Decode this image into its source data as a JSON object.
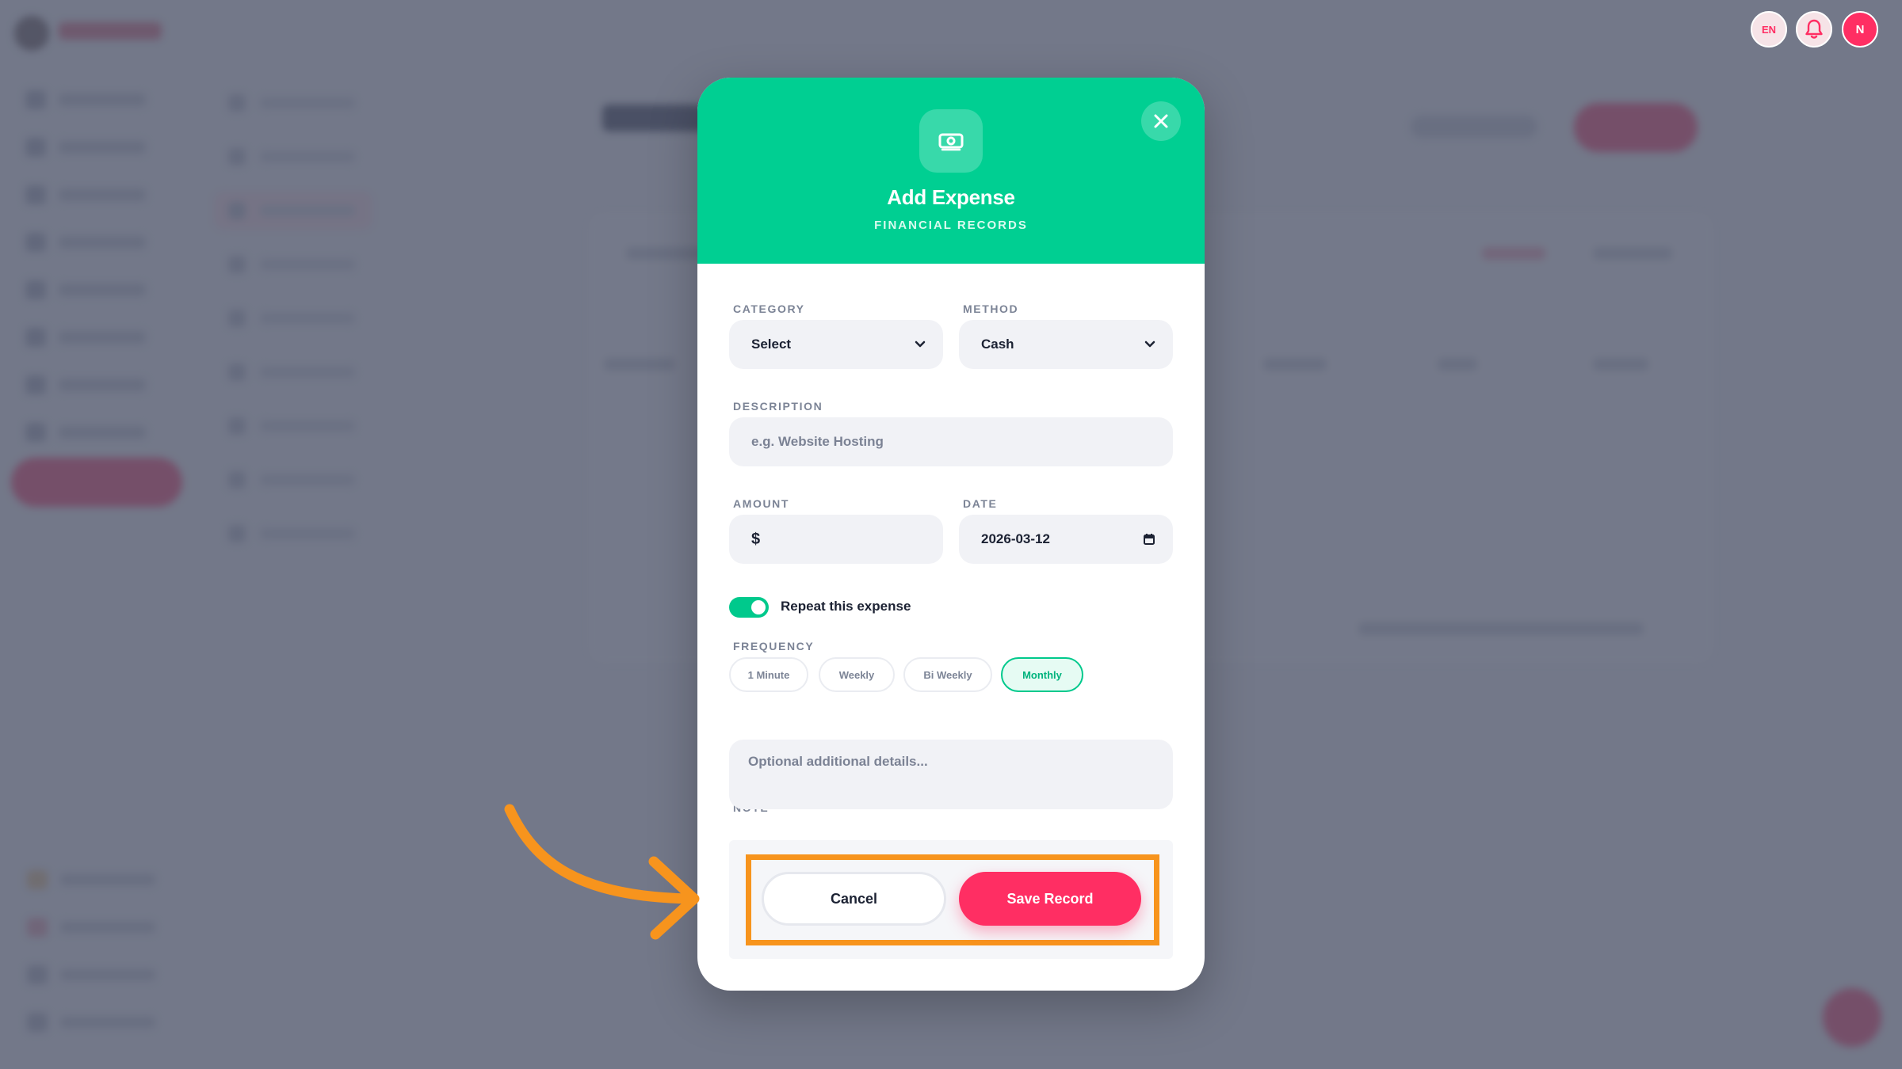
{
  "header": {
    "lang_label": "EN",
    "user_initial": "N"
  },
  "modal": {
    "title": "Add Expense",
    "subtitle": "FINANCIAL RECORDS",
    "header_icon": "money-icon",
    "close_icon": "close-icon"
  },
  "form": {
    "category": {
      "label": "CATEGORY",
      "value": "Select"
    },
    "method": {
      "label": "METHOD",
      "value": "Cash"
    },
    "description": {
      "label": "DESCRIPTION",
      "placeholder": "e.g. Website Hosting"
    },
    "amount": {
      "label": "AMOUNT",
      "currency": "$"
    },
    "date": {
      "label": "DATE",
      "value": "2026-03-12"
    },
    "repeat": {
      "label": "Repeat this expense",
      "enabled": true
    },
    "frequency": {
      "label": "FREQUENCY",
      "options": [
        "1 Minute",
        "Weekly",
        "Bi Weekly",
        "Monthly"
      ],
      "selected": "Monthly"
    },
    "note": {
      "label": "NOTE",
      "placeholder": "Optional additional details..."
    }
  },
  "actions": {
    "cancel_label": "Cancel",
    "save_label": "Save Record"
  },
  "colors": {
    "accent_green": "#00cf92",
    "accent_red": "#ff2e63",
    "highlight_orange": "#f7941d"
  }
}
